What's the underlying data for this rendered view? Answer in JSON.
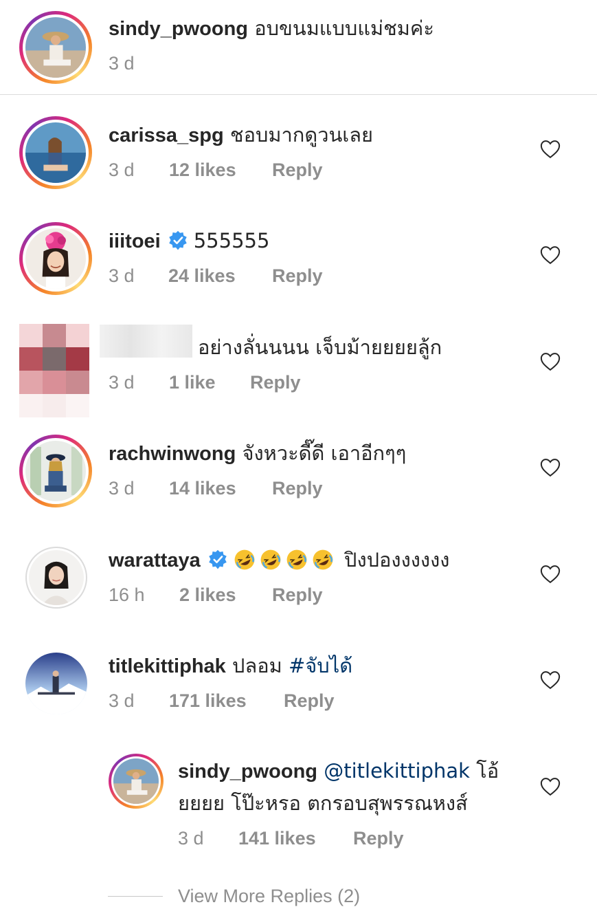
{
  "caption": {
    "username": "sindy_pwoong",
    "text": "อบขนมแบบแม่ชมค่ะ",
    "time": "3 d"
  },
  "comments": [
    {
      "username": "carissa_spg",
      "text": "ชอบมากดูวนเลย",
      "time": "3 d",
      "likes": "12 likes",
      "reply": "Reply"
    },
    {
      "username": "iiitoei",
      "verified": true,
      "text": "555555",
      "time": "3 d",
      "likes": "24 likes",
      "reply": "Reply"
    },
    {
      "username": "",
      "text": "อย่างลั่นนนน เจ็บม้ายยยยลู้ก",
      "time": "3 d",
      "likes": "1 like",
      "reply": "Reply"
    },
    {
      "username": "rachwinwong",
      "text": "จังหวะดี๊ดี เอาอีกๆๆ",
      "time": "3 d",
      "likes": "14 likes",
      "reply": "Reply"
    },
    {
      "username": "warattaya",
      "verified": true,
      "emoji": "rolling-on-floor-laughing",
      "text": "ปิงปองงงงงง",
      "time": "16 h",
      "likes": "2 likes",
      "reply": "Reply"
    },
    {
      "username": "titlekittiphak",
      "text": "ปลอม",
      "hashtag": "#จับได้",
      "time": "3 d",
      "likes": "171 likes",
      "reply": "Reply"
    }
  ],
  "reply": {
    "username": "sindy_pwoong",
    "mention": "@titlekittiphak",
    "text_line1": "โอ้",
    "text_line2": "ยยยย โป๊ะหรอ ตกรอบสุพรรณหงส์",
    "time": "3 d",
    "likes": "141 likes",
    "reply": "Reply"
  },
  "view_more": "View More Replies (2)",
  "colors": {
    "username": "#262626",
    "meta": "#8e8e8e",
    "link": "#003569",
    "verified": "#3897f0",
    "divider": "#dbdbdb"
  },
  "icons": {
    "like": "heart-outline-icon",
    "verified": "verified-badge-icon"
  }
}
